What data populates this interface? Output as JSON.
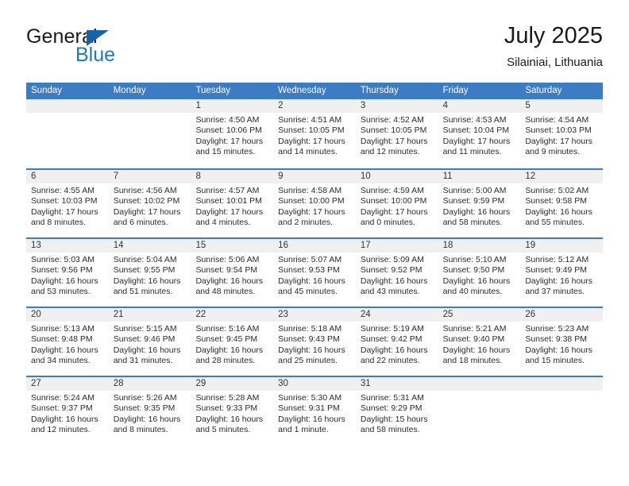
{
  "brand": {
    "name_top": "General",
    "name_bottom": "Blue",
    "triangle_color": "#1464aa",
    "blue_text_color": "#1a7bc4"
  },
  "header": {
    "month_title": "July 2025",
    "location": "Silainiai, Lithuania"
  },
  "theme": {
    "header_blue": "#3b7cc4",
    "day_band_gray": "#f0f0f0",
    "text_color": "#2b2b2b"
  },
  "weekdays": [
    "Sunday",
    "Monday",
    "Tuesday",
    "Wednesday",
    "Thursday",
    "Friday",
    "Saturday"
  ],
  "weeks": [
    [
      {
        "day": "",
        "lines": []
      },
      {
        "day": "",
        "lines": []
      },
      {
        "day": "1",
        "lines": [
          "Sunrise: 4:50 AM",
          "Sunset: 10:06 PM",
          "Daylight: 17 hours",
          "and 15 minutes."
        ]
      },
      {
        "day": "2",
        "lines": [
          "Sunrise: 4:51 AM",
          "Sunset: 10:05 PM",
          "Daylight: 17 hours",
          "and 14 minutes."
        ]
      },
      {
        "day": "3",
        "lines": [
          "Sunrise: 4:52 AM",
          "Sunset: 10:05 PM",
          "Daylight: 17 hours",
          "and 12 minutes."
        ]
      },
      {
        "day": "4",
        "lines": [
          "Sunrise: 4:53 AM",
          "Sunset: 10:04 PM",
          "Daylight: 17 hours",
          "and 11 minutes."
        ]
      },
      {
        "day": "5",
        "lines": [
          "Sunrise: 4:54 AM",
          "Sunset: 10:03 PM",
          "Daylight: 17 hours",
          "and 9 minutes."
        ]
      }
    ],
    [
      {
        "day": "6",
        "lines": [
          "Sunrise: 4:55 AM",
          "Sunset: 10:03 PM",
          "Daylight: 17 hours",
          "and 8 minutes."
        ]
      },
      {
        "day": "7",
        "lines": [
          "Sunrise: 4:56 AM",
          "Sunset: 10:02 PM",
          "Daylight: 17 hours",
          "and 6 minutes."
        ]
      },
      {
        "day": "8",
        "lines": [
          "Sunrise: 4:57 AM",
          "Sunset: 10:01 PM",
          "Daylight: 17 hours",
          "and 4 minutes."
        ]
      },
      {
        "day": "9",
        "lines": [
          "Sunrise: 4:58 AM",
          "Sunset: 10:00 PM",
          "Daylight: 17 hours",
          "and 2 minutes."
        ]
      },
      {
        "day": "10",
        "lines": [
          "Sunrise: 4:59 AM",
          "Sunset: 10:00 PM",
          "Daylight: 17 hours",
          "and 0 minutes."
        ]
      },
      {
        "day": "11",
        "lines": [
          "Sunrise: 5:00 AM",
          "Sunset: 9:59 PM",
          "Daylight: 16 hours",
          "and 58 minutes."
        ]
      },
      {
        "day": "12",
        "lines": [
          "Sunrise: 5:02 AM",
          "Sunset: 9:58 PM",
          "Daylight: 16 hours",
          "and 55 minutes."
        ]
      }
    ],
    [
      {
        "day": "13",
        "lines": [
          "Sunrise: 5:03 AM",
          "Sunset: 9:56 PM",
          "Daylight: 16 hours",
          "and 53 minutes."
        ]
      },
      {
        "day": "14",
        "lines": [
          "Sunrise: 5:04 AM",
          "Sunset: 9:55 PM",
          "Daylight: 16 hours",
          "and 51 minutes."
        ]
      },
      {
        "day": "15",
        "lines": [
          "Sunrise: 5:06 AM",
          "Sunset: 9:54 PM",
          "Daylight: 16 hours",
          "and 48 minutes."
        ]
      },
      {
        "day": "16",
        "lines": [
          "Sunrise: 5:07 AM",
          "Sunset: 9:53 PM",
          "Daylight: 16 hours",
          "and 45 minutes."
        ]
      },
      {
        "day": "17",
        "lines": [
          "Sunrise: 5:09 AM",
          "Sunset: 9:52 PM",
          "Daylight: 16 hours",
          "and 43 minutes."
        ]
      },
      {
        "day": "18",
        "lines": [
          "Sunrise: 5:10 AM",
          "Sunset: 9:50 PM",
          "Daylight: 16 hours",
          "and 40 minutes."
        ]
      },
      {
        "day": "19",
        "lines": [
          "Sunrise: 5:12 AM",
          "Sunset: 9:49 PM",
          "Daylight: 16 hours",
          "and 37 minutes."
        ]
      }
    ],
    [
      {
        "day": "20",
        "lines": [
          "Sunrise: 5:13 AM",
          "Sunset: 9:48 PM",
          "Daylight: 16 hours",
          "and 34 minutes."
        ]
      },
      {
        "day": "21",
        "lines": [
          "Sunrise: 5:15 AM",
          "Sunset: 9:46 PM",
          "Daylight: 16 hours",
          "and 31 minutes."
        ]
      },
      {
        "day": "22",
        "lines": [
          "Sunrise: 5:16 AM",
          "Sunset: 9:45 PM",
          "Daylight: 16 hours",
          "and 28 minutes."
        ]
      },
      {
        "day": "23",
        "lines": [
          "Sunrise: 5:18 AM",
          "Sunset: 9:43 PM",
          "Daylight: 16 hours",
          "and 25 minutes."
        ]
      },
      {
        "day": "24",
        "lines": [
          "Sunrise: 5:19 AM",
          "Sunset: 9:42 PM",
          "Daylight: 16 hours",
          "and 22 minutes."
        ]
      },
      {
        "day": "25",
        "lines": [
          "Sunrise: 5:21 AM",
          "Sunset: 9:40 PM",
          "Daylight: 16 hours",
          "and 18 minutes."
        ]
      },
      {
        "day": "26",
        "lines": [
          "Sunrise: 5:23 AM",
          "Sunset: 9:38 PM",
          "Daylight: 16 hours",
          "and 15 minutes."
        ]
      }
    ],
    [
      {
        "day": "27",
        "lines": [
          "Sunrise: 5:24 AM",
          "Sunset: 9:37 PM",
          "Daylight: 16 hours",
          "and 12 minutes."
        ]
      },
      {
        "day": "28",
        "lines": [
          "Sunrise: 5:26 AM",
          "Sunset: 9:35 PM",
          "Daylight: 16 hours",
          "and 8 minutes."
        ]
      },
      {
        "day": "29",
        "lines": [
          "Sunrise: 5:28 AM",
          "Sunset: 9:33 PM",
          "Daylight: 16 hours",
          "and 5 minutes."
        ]
      },
      {
        "day": "30",
        "lines": [
          "Sunrise: 5:30 AM",
          "Sunset: 9:31 PM",
          "Daylight: 16 hours",
          "and 1 minute."
        ]
      },
      {
        "day": "31",
        "lines": [
          "Sunrise: 5:31 AM",
          "Sunset: 9:29 PM",
          "Daylight: 15 hours",
          "and 58 minutes."
        ]
      },
      {
        "day": "",
        "lines": []
      },
      {
        "day": "",
        "lines": []
      }
    ]
  ]
}
